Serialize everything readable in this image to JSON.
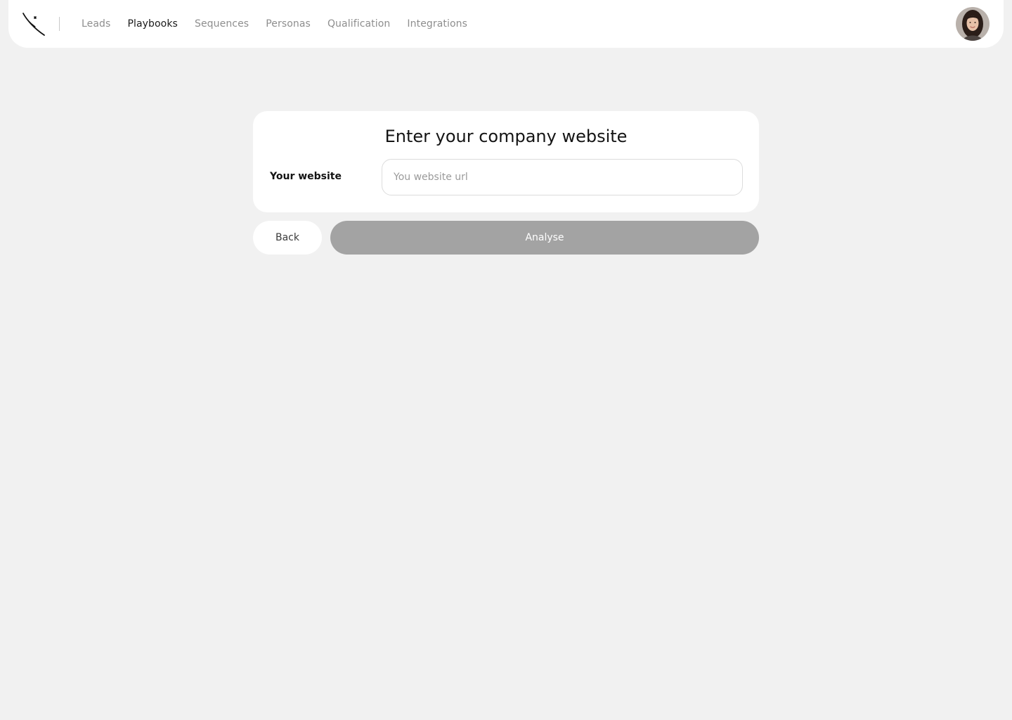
{
  "header": {
    "logo_icon": "orbit-star-logo-icon",
    "nav": [
      {
        "label": "Leads",
        "active": false
      },
      {
        "label": "Playbooks",
        "active": true
      },
      {
        "label": "Sequences",
        "active": false
      },
      {
        "label": "Personas",
        "active": false
      },
      {
        "label": "Qualification",
        "active": false
      },
      {
        "label": "Integrations",
        "active": false
      }
    ],
    "avatar_icon": "user-avatar"
  },
  "form": {
    "title": "Enter your company website",
    "website_label": "Your website",
    "website_placeholder": "You website url",
    "website_value": ""
  },
  "actions": {
    "back_label": "Back",
    "analyse_label": "Analyse"
  },
  "colors": {
    "page_background": "#f1f1f1",
    "surface": "#ffffff",
    "analyse_disabled": "#a3a3a3",
    "nav_active": "#1a1a1a",
    "nav_inactive": "#8e8e8e"
  }
}
